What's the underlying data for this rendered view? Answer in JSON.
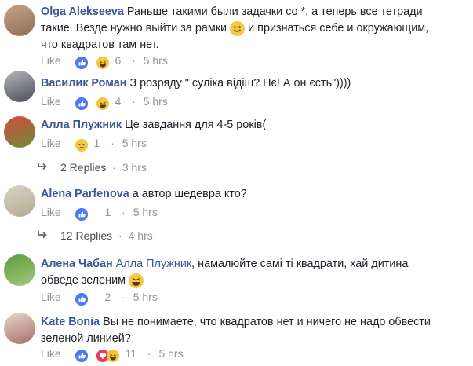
{
  "comments": [
    {
      "author": "Olga Alekseeva",
      "text_line1": "Раньше такими были задачки со *, а теперь все тетради",
      "text_line2a": "такие. Везде нужно выйти за рамки",
      "text_line2b": "и признаться себе и окружающим,",
      "text_line3": "что квадратов там нет.",
      "like_label": "Like",
      "reactions": [
        "like-icon",
        "laugh-icon"
      ],
      "reaction_count": "6",
      "time": "5 hrs",
      "avatar_colors": [
        "#c7a484",
        "#8f6d57"
      ]
    },
    {
      "author": "Василик Роман",
      "text": "З розряду \" суліка відіш? Нє! А он єсть\"))))",
      "like_label": "Like",
      "reactions": [
        "like-icon",
        "laugh-icon"
      ],
      "reaction_count": "4",
      "time": "5 hrs",
      "avatar_colors": [
        "#b6b7bb",
        "#4a4e57"
      ]
    },
    {
      "author": "Алла Плужник",
      "text": "Це завдання для 4-5 років(",
      "like_label": "Like",
      "reactions": [
        "sad-icon"
      ],
      "reaction_count": "1",
      "time": "5 hrs",
      "replies_label": "2 Replies",
      "replies_time": "3 hrs",
      "avatar_colors": [
        "#d44c3d",
        "#6f8a3c"
      ]
    },
    {
      "author": "Alena Parfenova",
      "text": "а автор шедевра кто?",
      "like_label": "Like",
      "reactions": [
        "like-icon"
      ],
      "reaction_count": "1",
      "time": "5 hrs",
      "replies_label": "12 Replies",
      "replies_time": "4 hrs",
      "avatar_colors": [
        "#d9d4ca",
        "#b5a98f"
      ]
    },
    {
      "author": "Алена Чабан",
      "mention": "Алла Плужник",
      "text_line1": ", намалюйте самі ті квадрати, хай дитина",
      "text_line2": "обведе зеленим",
      "like_label": "Like",
      "reactions": [
        "like-icon"
      ],
      "reaction_count": "2",
      "time": "5 hrs",
      "avatar_colors": [
        "#5c9b3e",
        "#a4c97a"
      ]
    },
    {
      "author": "Kate Bonia",
      "text_line1": "Вы не понимаете, что квадратов нет и ничего не надо обвести",
      "text_line2": "зеленой линией?",
      "like_label": "Like",
      "reactions": [
        "like-icon",
        "love-icon",
        "laugh-icon"
      ],
      "reaction_count": "11",
      "time": "5 hrs",
      "avatar_colors": [
        "#e6d8cf",
        "#a86f64"
      ]
    }
  ],
  "separator": "·",
  "colors": {
    "link": "#385898",
    "meta": "#90949c",
    "like_blue": "#4b7bf5",
    "emoji_yellow": "#f7c63f",
    "love_red": "#f0395a"
  }
}
